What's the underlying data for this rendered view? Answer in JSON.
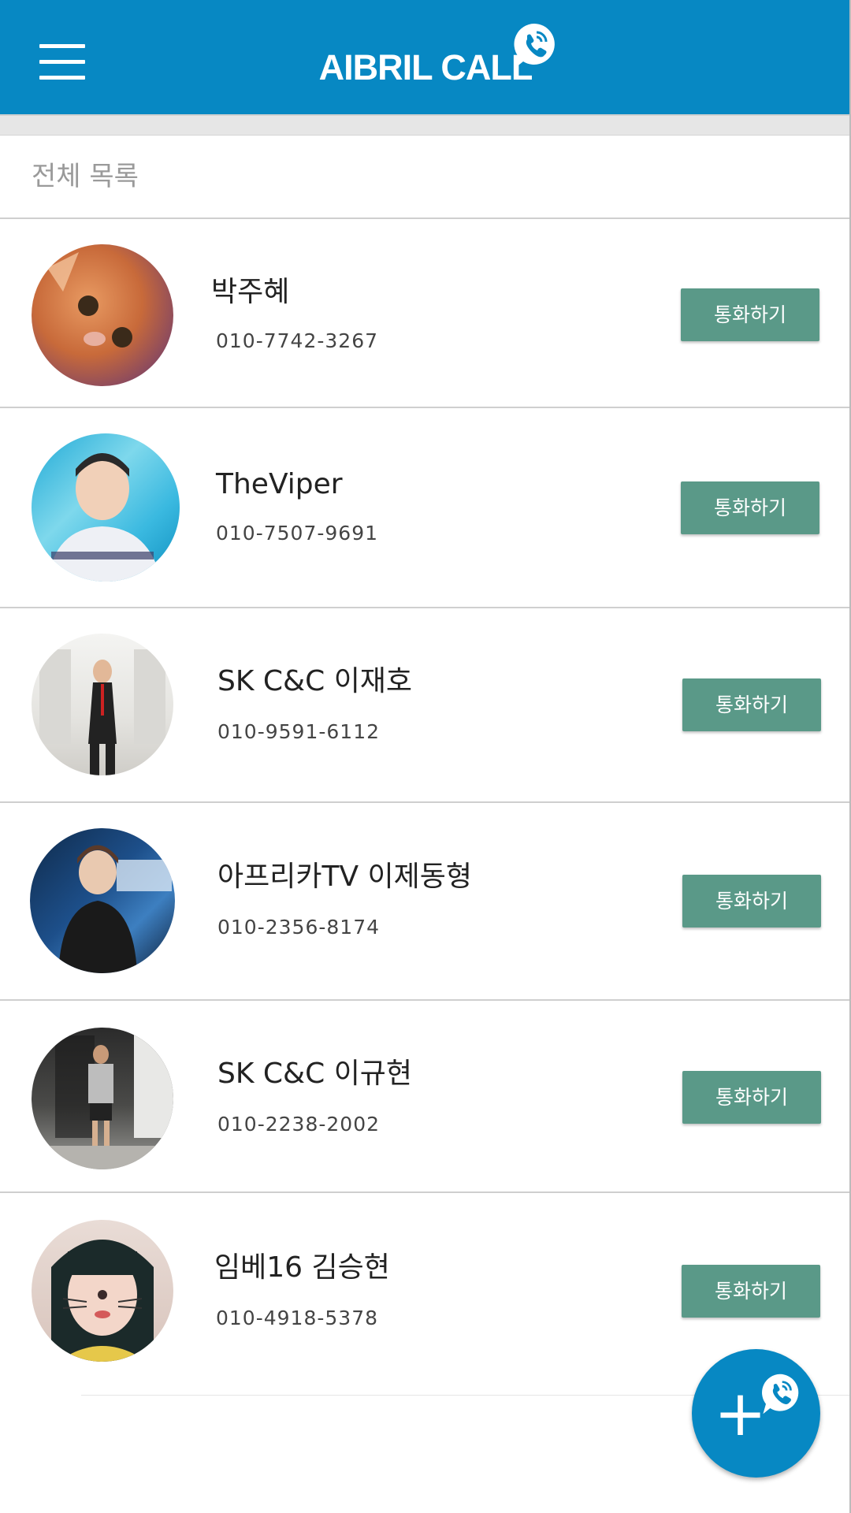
{
  "header": {
    "title": "AIBRIL CALL",
    "menu_icon": "hamburger-menu-icon",
    "logo_icon": "phone-chat-bubble-icon",
    "color": "#0788c3"
  },
  "list": {
    "title": "전체 목록",
    "call_button_color": "#5a9988",
    "contacts": [
      {
        "name": "박주혜",
        "phone": "010-7742-3267",
        "call_label": "통화하기"
      },
      {
        "name": "TheViper",
        "phone": "010-7507-9691",
        "call_label": "통화하기"
      },
      {
        "name": "SK C&C 이재호",
        "phone": "010-9591-6112",
        "call_label": "통화하기"
      },
      {
        "name": "아프리카TV 이제동형",
        "phone": "010-2356-8174",
        "call_label": "통화하기"
      },
      {
        "name": "SK C&C 이규현",
        "phone": "010-2238-2002",
        "call_label": "통화하기"
      },
      {
        "name": "임베16 김승현",
        "phone": "010-4918-5378",
        "call_label": "통화하기"
      }
    ]
  },
  "fab": {
    "label": "+",
    "icon": "add-call-icon"
  }
}
